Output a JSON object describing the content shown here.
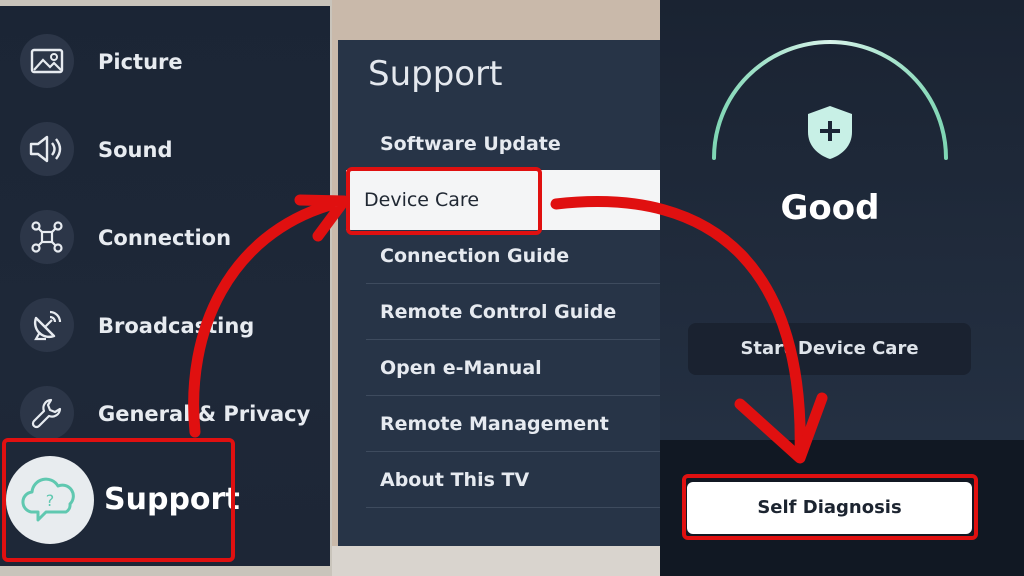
{
  "settings_menu": {
    "items": [
      {
        "label": "Picture",
        "icon": "picture-icon"
      },
      {
        "label": "Sound",
        "icon": "speaker-icon"
      },
      {
        "label": "Connection",
        "icon": "network-icon"
      },
      {
        "label": "Broadcasting",
        "icon": "satellite-dish-icon"
      },
      {
        "label": "General & Privacy",
        "icon": "wrench-icon"
      }
    ],
    "selected": {
      "label": "Support",
      "icon": "cloud-help-icon"
    }
  },
  "support_menu": {
    "title": "Support",
    "items": [
      "Software Update",
      "Device Care",
      "Connection Guide",
      "Remote Control Guide",
      "Open e-Manual",
      "Remote Management",
      "About This TV"
    ]
  },
  "device_care": {
    "status": "Good",
    "start_button": "Start Device Care",
    "self_diagnosis_button": "Self Diagnosis"
  },
  "colors": {
    "highlight_red": "#e01010",
    "gauge_green": "#9ee3c4",
    "shield_mint": "#c8f0e6"
  }
}
